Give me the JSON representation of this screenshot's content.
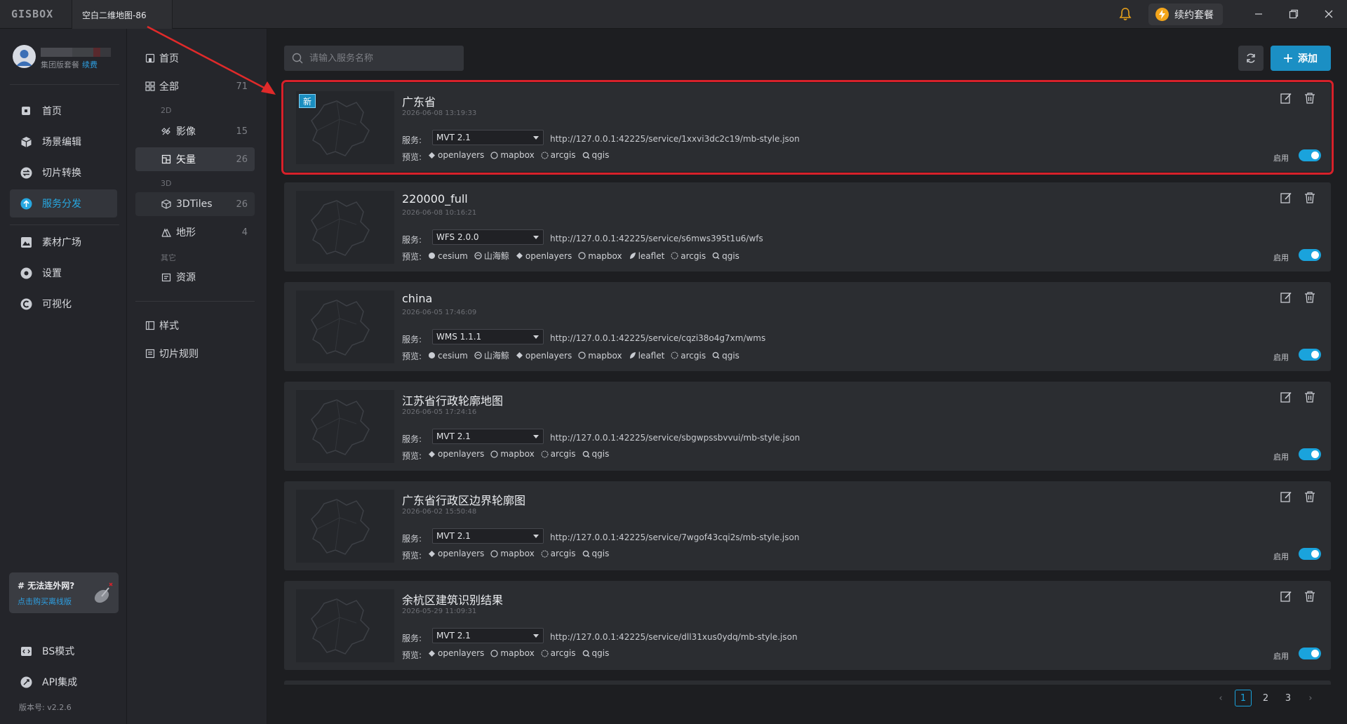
{
  "titlebar": {
    "logo": "GISBOX",
    "doc_tab": "空白二维地图-86",
    "renew_label": "续约套餐"
  },
  "user": {
    "plan": "集团版套餐",
    "renew": "续费"
  },
  "leftnav": {
    "items": [
      {
        "label": "首页",
        "icon": "home-icon"
      },
      {
        "label": "场景编辑",
        "icon": "cube-icon"
      },
      {
        "label": "切片转换",
        "icon": "convert-icon"
      },
      {
        "label": "服务分发",
        "icon": "upload-cloud-icon",
        "active": true
      },
      {
        "label": "素材广场",
        "icon": "image-icon"
      },
      {
        "label": "设置",
        "icon": "settings-icon"
      },
      {
        "label": "可视化",
        "icon": "visualize-icon"
      }
    ],
    "offline_title": "# 无法连外网?",
    "offline_link": "点击购买离线版",
    "bottom_items": [
      {
        "label": "BS模式",
        "icon": "code-icon"
      },
      {
        "label": "API集成",
        "icon": "api-icon"
      }
    ],
    "version": "版本号: v2.2.6"
  },
  "categories": {
    "home": "首页",
    "all": {
      "label": "全部",
      "count": "71"
    },
    "group_2d": "2D",
    "imagery": {
      "label": "影像",
      "count": "15"
    },
    "vector": {
      "label": "矢量",
      "count": "26"
    },
    "group_3d": "3D",
    "tiles3d": {
      "label": "3DTiles",
      "count": "26"
    },
    "terrain": {
      "label": "地形",
      "count": "4"
    },
    "group_other": "其它",
    "resources": {
      "label": "资源"
    },
    "styles": "样式",
    "tile_rules": "切片规则"
  },
  "toolbar": {
    "search_placeholder": "请输入服务名称",
    "add_label": "添加"
  },
  "labels": {
    "service": "服务:",
    "preview": "预览:",
    "enable": "启用",
    "new_badge": "新"
  },
  "services": [
    {
      "title": "广东省",
      "date": "2026-06-08 13:19:33",
      "type": "MVT 2.1",
      "url": "http://127.0.0.1:42225/service/1xxvi3dc2c19/mb-style.json",
      "previews": [
        "openlayers",
        "mapbox",
        "arcgis",
        "qgis"
      ],
      "is_new": true,
      "enabled": true
    },
    {
      "title": "220000_full",
      "date": "2026-06-08 10:16:21",
      "type": "WFS 2.0.0",
      "url": "http://127.0.0.1:42225/service/s6mws395t1u6/wfs",
      "previews": [
        "cesium",
        "山海鲸",
        "openlayers",
        "mapbox",
        "leaflet",
        "arcgis",
        "qgis"
      ],
      "is_new": false,
      "enabled": true
    },
    {
      "title": "china",
      "date": "2026-06-05 17:46:09",
      "type": "WMS 1.1.1",
      "url": "http://127.0.0.1:42225/service/cqzi38o4g7xm/wms",
      "previews": [
        "cesium",
        "山海鲸",
        "openlayers",
        "mapbox",
        "leaflet",
        "arcgis",
        "qgis"
      ],
      "is_new": false,
      "enabled": true
    },
    {
      "title": "江苏省行政轮廓地图",
      "date": "2026-06-05 17:24:16",
      "type": "MVT 2.1",
      "url": "http://127.0.0.1:42225/service/sbgwpssbvvui/mb-style.json",
      "previews": [
        "openlayers",
        "mapbox",
        "arcgis",
        "qgis"
      ],
      "is_new": false,
      "enabled": true
    },
    {
      "title": "广东省行政区边界轮廓图",
      "date": "2026-06-02 15:50:48",
      "type": "MVT 2.1",
      "url": "http://127.0.0.1:42225/service/7wgof43cqi2s/mb-style.json",
      "previews": [
        "openlayers",
        "mapbox",
        "arcgis",
        "qgis"
      ],
      "is_new": false,
      "enabled": true
    },
    {
      "title": "余杭区建筑识别结果",
      "date": "2026-05-29 11:09:31",
      "type": "MVT 2.1",
      "url": "http://127.0.0.1:42225/service/dll31xus0ydq/mb-style.json",
      "previews": [
        "openlayers",
        "mapbox",
        "arcgis",
        "qgis"
      ],
      "is_new": false,
      "enabled": true
    }
  ],
  "pagination": {
    "pages": [
      "1",
      "2",
      "3"
    ],
    "current": "1",
    "prev": "‹",
    "next": "›"
  },
  "colors": {
    "accent": "#1aa3dc",
    "highlight_frame": "#d7212a",
    "add_button": "#1b8fc4"
  }
}
